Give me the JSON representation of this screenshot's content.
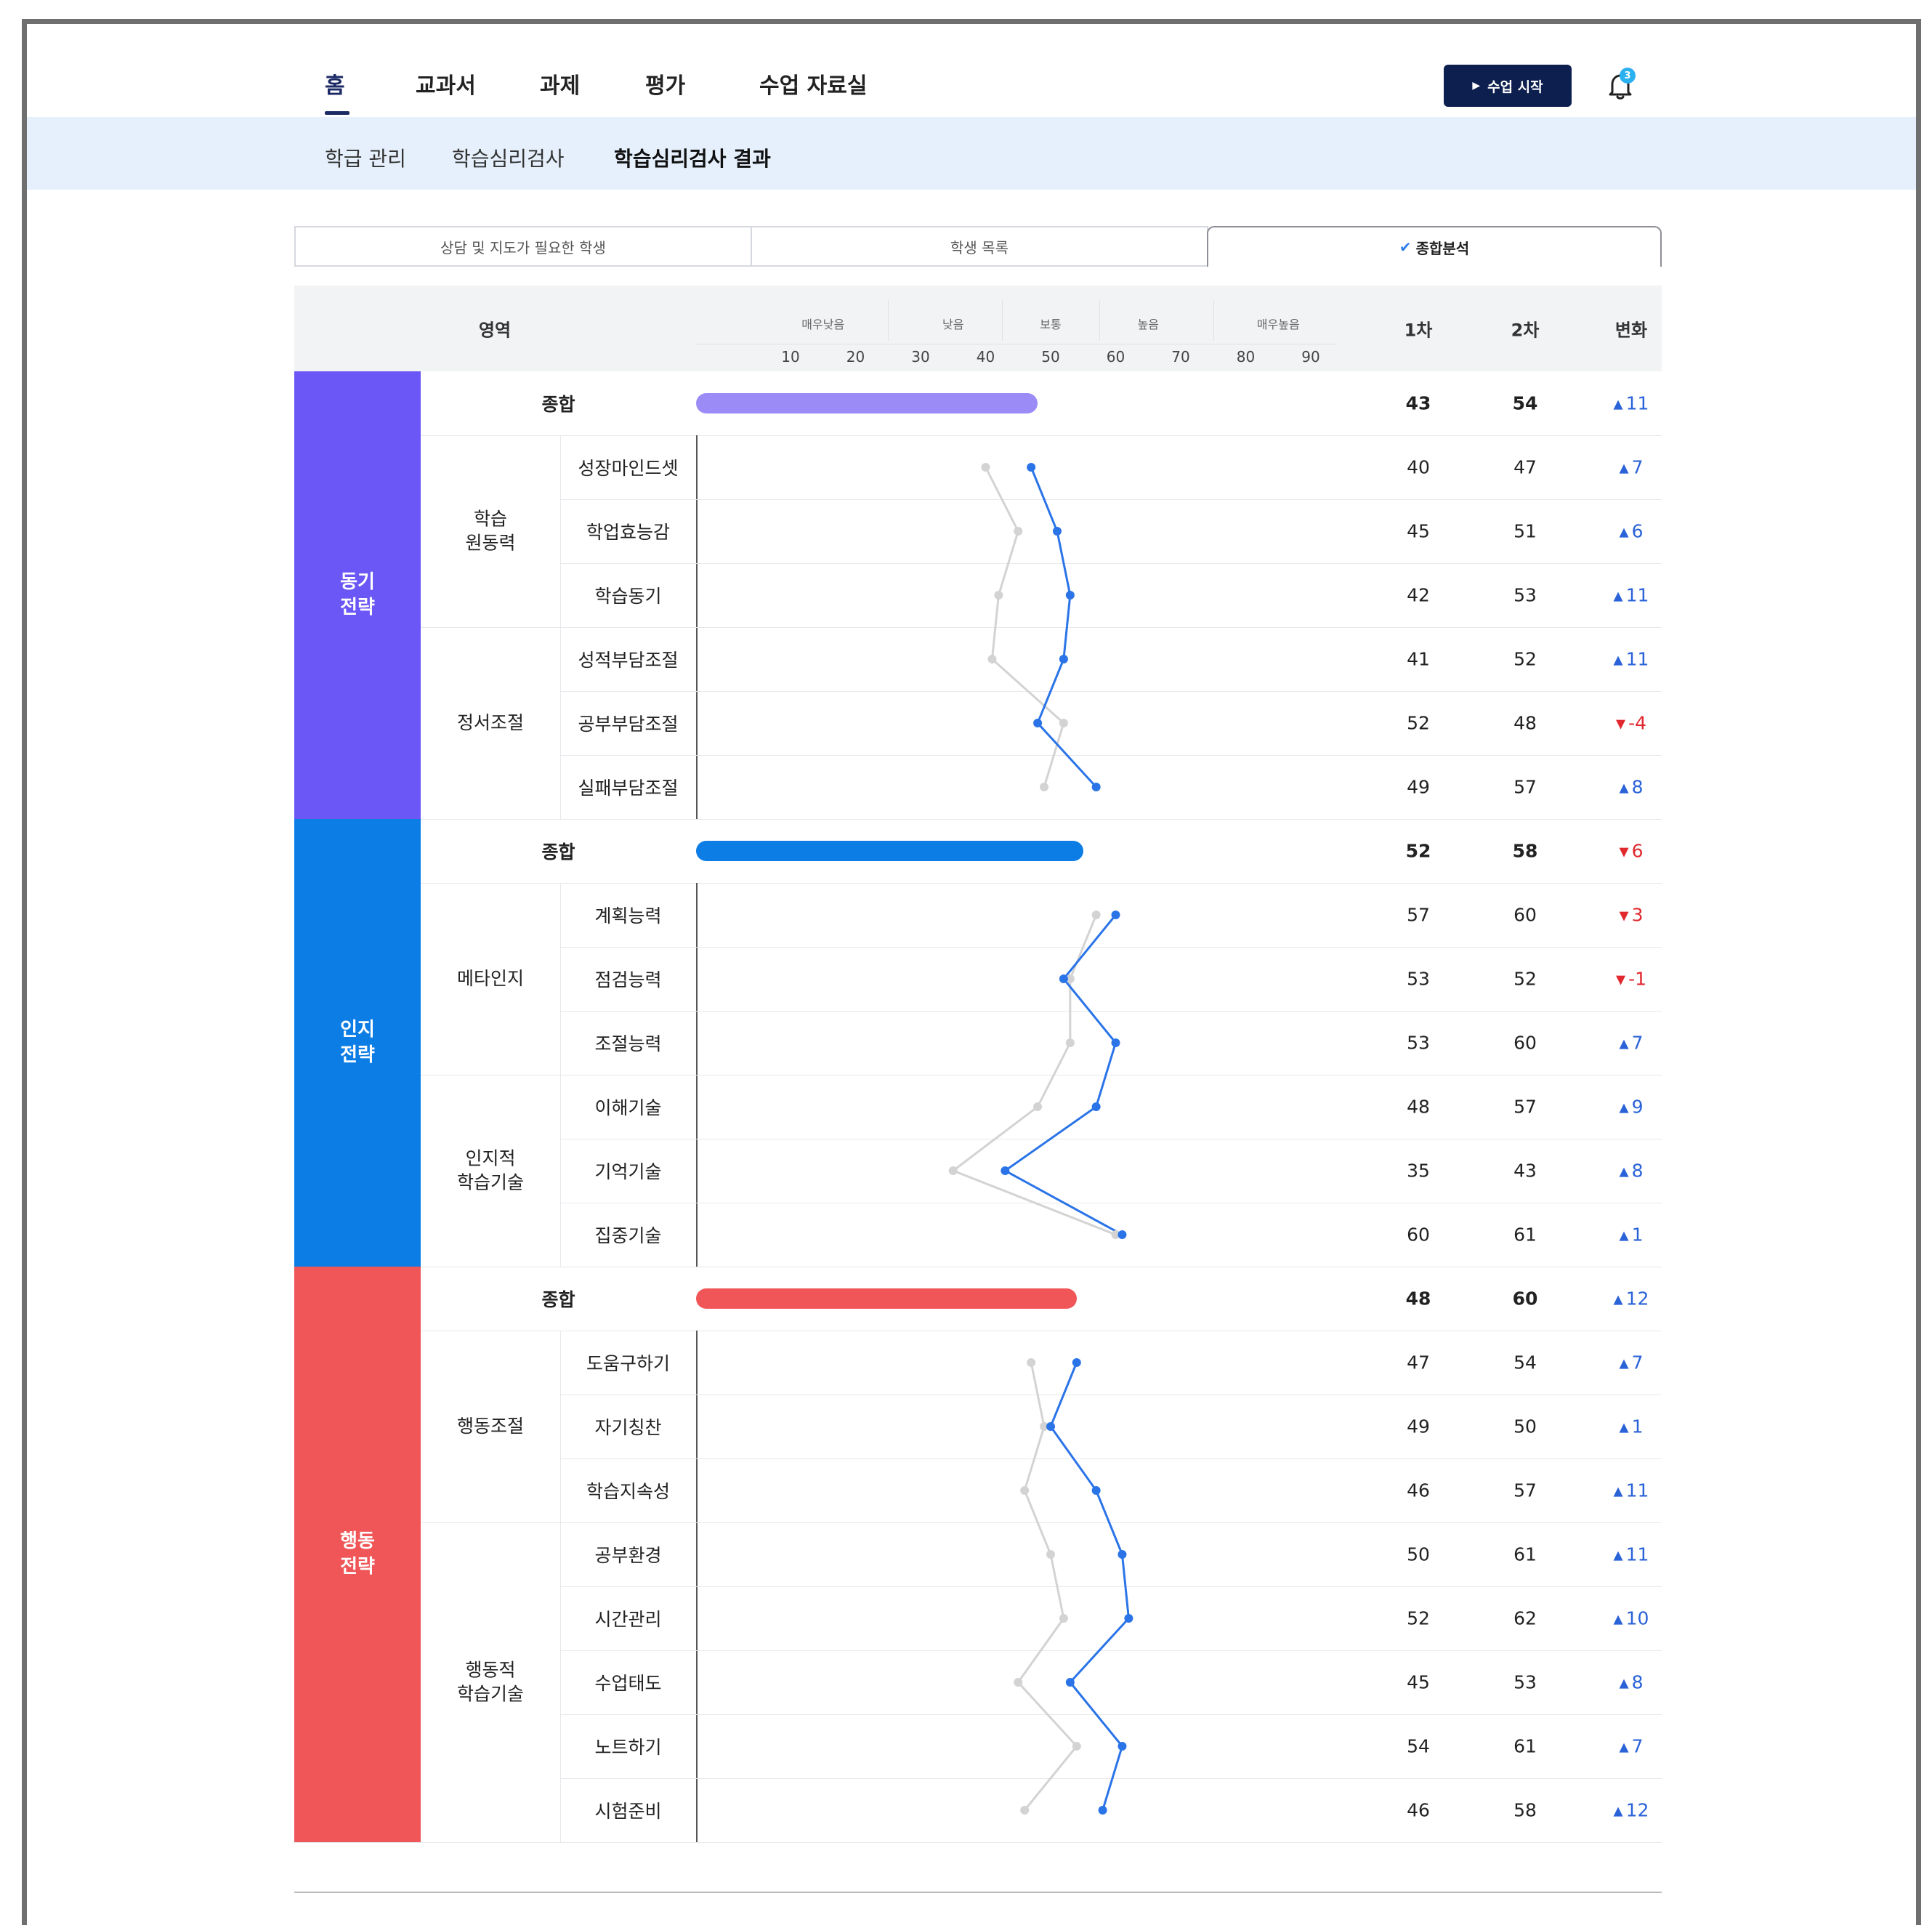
{
  "nav": {
    "tabs": [
      "홈",
      "교과서",
      "과제",
      "평가",
      "수업 자료실"
    ],
    "active_index": 0,
    "start_button": "수업 시작",
    "notification_count": "3"
  },
  "subnav": {
    "items": [
      "학급 관리",
      "학습심리검사",
      "학습심리검사 결과"
    ],
    "active_index": 2
  },
  "view_tabs": {
    "items": [
      "상담 및 지도가 필요한 학생",
      "학생 목록",
      "종합분석"
    ],
    "active_index": 2
  },
  "table": {
    "headers": {
      "area": "영역",
      "first": "1차",
      "second": "2차",
      "change": "변화"
    },
    "scale_labels": [
      "매우낮음",
      "낮음",
      "보통",
      "높음",
      "매우높음"
    ],
    "scale_ticks": [
      "10",
      "20",
      "30",
      "40",
      "50",
      "60",
      "70",
      "80",
      "90"
    ],
    "total_label": "종합",
    "colors": {
      "first_line": "#d3d3d3",
      "second_line": "#2a74e8",
      "increase": "#2a62d8",
      "decrease": "#e0282e"
    },
    "categories": [
      {
        "name": "동기\n전략",
        "color": "#6b57f5",
        "total": {
          "first": "43",
          "second": "54",
          "change": "11",
          "dir": "up",
          "bar_value": 48,
          "bar_color": "#9b8bf7"
        },
        "groups": [
          {
            "name": "학습\n원동력",
            "items": [
              {
                "label": "성장마인드셋",
                "first": "40",
                "second": "47",
                "change": "7",
                "dir": "up"
              },
              {
                "label": "학업효능감",
                "first": "45",
                "second": "51",
                "change": "6",
                "dir": "up"
              },
              {
                "label": "학습동기",
                "first": "42",
                "second": "53",
                "change": "11",
                "dir": "up"
              }
            ]
          },
          {
            "name": "정서조절",
            "items": [
              {
                "label": "성적부담조절",
                "first": "41",
                "second": "52",
                "change": "11",
                "dir": "up"
              },
              {
                "label": "공부부담조절",
                "first": "52",
                "second": "48",
                "change": "-4",
                "dir": "down"
              },
              {
                "label": "실패부담조절",
                "first": "49",
                "second": "57",
                "change": "8",
                "dir": "up"
              }
            ]
          }
        ]
      },
      {
        "name": "인지\n전략",
        "color": "#0d7de6",
        "total": {
          "first": "52",
          "second": "58",
          "change": "6",
          "dir": "down",
          "bar_value": 55,
          "bar_color": "#0d7de6"
        },
        "groups": [
          {
            "name": "메타인지",
            "items": [
              {
                "label": "계획능력",
                "first": "57",
                "second": "60",
                "change": "3",
                "dir": "down"
              },
              {
                "label": "점검능력",
                "first": "53",
                "second": "52",
                "change": "-1",
                "dir": "down"
              },
              {
                "label": "조절능력",
                "first": "53",
                "second": "60",
                "change": "7",
                "dir": "up"
              }
            ]
          },
          {
            "name": "인지적\n학습기술",
            "items": [
              {
                "label": "이해기술",
                "first": "48",
                "second": "57",
                "change": "9",
                "dir": "up"
              },
              {
                "label": "기억기술",
                "first": "35",
                "second": "43",
                "change": "8",
                "dir": "up"
              },
              {
                "label": "집중기술",
                "first": "60",
                "second": "61",
                "change": "1",
                "dir": "up"
              }
            ]
          }
        ]
      },
      {
        "name": "행동\n전략",
        "color": "#f05658",
        "total": {
          "first": "48",
          "second": "60",
          "change": "12",
          "dir": "up",
          "bar_value": 54,
          "bar_color": "#f05658"
        },
        "groups": [
          {
            "name": "행동조절",
            "items": [
              {
                "label": "도움구하기",
                "first": "47",
                "second": "54",
                "change": "7",
                "dir": "up"
              },
              {
                "label": "자기칭찬",
                "first": "49",
                "second": "50",
                "change": "1",
                "dir": "up"
              },
              {
                "label": "학습지속성",
                "first": "46",
                "second": "57",
                "change": "11",
                "dir": "up"
              }
            ]
          },
          {
            "name": "행동적\n학습기술",
            "items": [
              {
                "label": "공부환경",
                "first": "50",
                "second": "61",
                "change": "11",
                "dir": "up"
              },
              {
                "label": "시간관리",
                "first": "52",
                "second": "62",
                "change": "10",
                "dir": "up"
              },
              {
                "label": "수업태도",
                "first": "45",
                "second": "53",
                "change": "8",
                "dir": "up"
              },
              {
                "label": "노트하기",
                "first": "54",
                "second": "61",
                "change": "7",
                "dir": "up"
              },
              {
                "label": "시험준비",
                "first": "46",
                "second": "58",
                "change": "12",
                "dir": "up"
              }
            ]
          }
        ]
      }
    ]
  }
}
